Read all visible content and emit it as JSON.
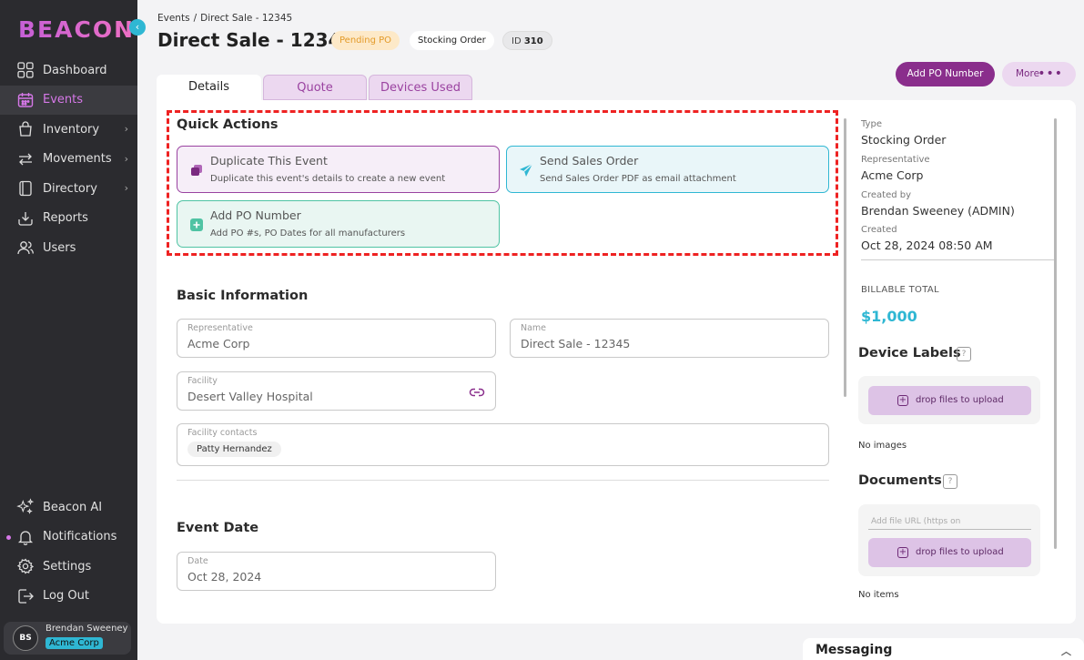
{
  "brand": {
    "logo_text": "BEACON",
    "collapse_glyph": "‹"
  },
  "sidebar": {
    "items": [
      {
        "label": "Dashboard",
        "icon": "grid-icon",
        "active": false,
        "has_children": false
      },
      {
        "label": "Events",
        "icon": "calendar-icon",
        "active": true,
        "has_children": false
      },
      {
        "label": "Inventory",
        "icon": "bag-icon",
        "active": false,
        "has_children": true
      },
      {
        "label": "Movements",
        "icon": "arrows-icon",
        "active": false,
        "has_children": true
      },
      {
        "label": "Directory",
        "icon": "book-icon",
        "active": false,
        "has_children": true
      },
      {
        "label": "Reports",
        "icon": "download-tray-icon",
        "active": false,
        "has_children": false
      },
      {
        "label": "Users",
        "icon": "users-icon",
        "active": false,
        "has_children": false
      }
    ],
    "bottom_items": [
      {
        "label": "Beacon AI",
        "icon": "sparkle-icon"
      },
      {
        "label": "Notifications",
        "icon": "bell-icon"
      },
      {
        "label": "Settings",
        "icon": "gear-icon"
      },
      {
        "label": "Log Out",
        "icon": "logout-icon"
      }
    ],
    "user": {
      "initials": "BS",
      "name": "Brendan Sweeney",
      "org": "Acme Corp"
    }
  },
  "header": {
    "breadcrumb": [
      "Events",
      "/",
      "Direct Sale - 12345"
    ],
    "title": "Direct Sale - 12345",
    "status_badge": "Pending PO",
    "type_badge": "Stocking Order",
    "id_label": "ID",
    "id_value": "310",
    "add_po_button": "Add PO Number",
    "more_button": "More",
    "more_dots": "•••"
  },
  "tabs": [
    {
      "label": "Details",
      "active": true
    },
    {
      "label": "Quote",
      "active": false
    },
    {
      "label": "Devices Used",
      "active": false
    }
  ],
  "quick_actions": {
    "title": "Quick Actions",
    "items": [
      {
        "title": "Duplicate This Event",
        "description": "Duplicate this event's details to create a new event",
        "icon": "duplicate-icon"
      },
      {
        "title": "Send Sales Order",
        "description": "Send Sales Order PDF as email attachment",
        "icon": "paper-plane-icon"
      },
      {
        "title": "Add PO Number",
        "description": "Add PO #s, PO Dates for all manufacturers",
        "icon": "plus-square-icon"
      }
    ]
  },
  "basic_info": {
    "title": "Basic Information",
    "representative": {
      "label": "Representative",
      "value": "Acme Corp"
    },
    "name": {
      "label": "Name",
      "value": "Direct Sale - 12345"
    },
    "facility": {
      "label": "Facility",
      "value": "Desert Valley Hospital"
    },
    "facility_contacts": {
      "label": "Facility contacts",
      "chips": [
        "Patty Hernandez"
      ]
    }
  },
  "event_date": {
    "title": "Event Date",
    "date": {
      "label": "Date",
      "value": "Oct 28, 2024"
    }
  },
  "side_panel": {
    "type_label": "Type",
    "type_value": "Stocking Order",
    "rep_label": "Representative",
    "rep_value": "Acme Corp",
    "created_by_label": "Created by",
    "created_by_value": "Brendan Sweeney (ADMIN)",
    "created_label": "Created",
    "created_value": "Oct 28, 2024 08:50 AM",
    "billable_label": "BILLABLE TOTAL",
    "billable_value": "$1,000",
    "device_labels_title": "Device Labels",
    "help_glyph": "?",
    "drop_label": "drop files to upload",
    "plus_glyph": "+",
    "no_images": "No images",
    "documents_title": "Documents",
    "url_placeholder": "Add file URL (https on",
    "no_items": "No items"
  },
  "messaging": {
    "label": "Messaging",
    "chevron": "︿"
  },
  "colors": {
    "accent_purple": "#8a2e8c",
    "accent_cyan": "#2fb7d3",
    "sidebar_bg": "#2b2b2f",
    "pending": "#e39b2a"
  }
}
